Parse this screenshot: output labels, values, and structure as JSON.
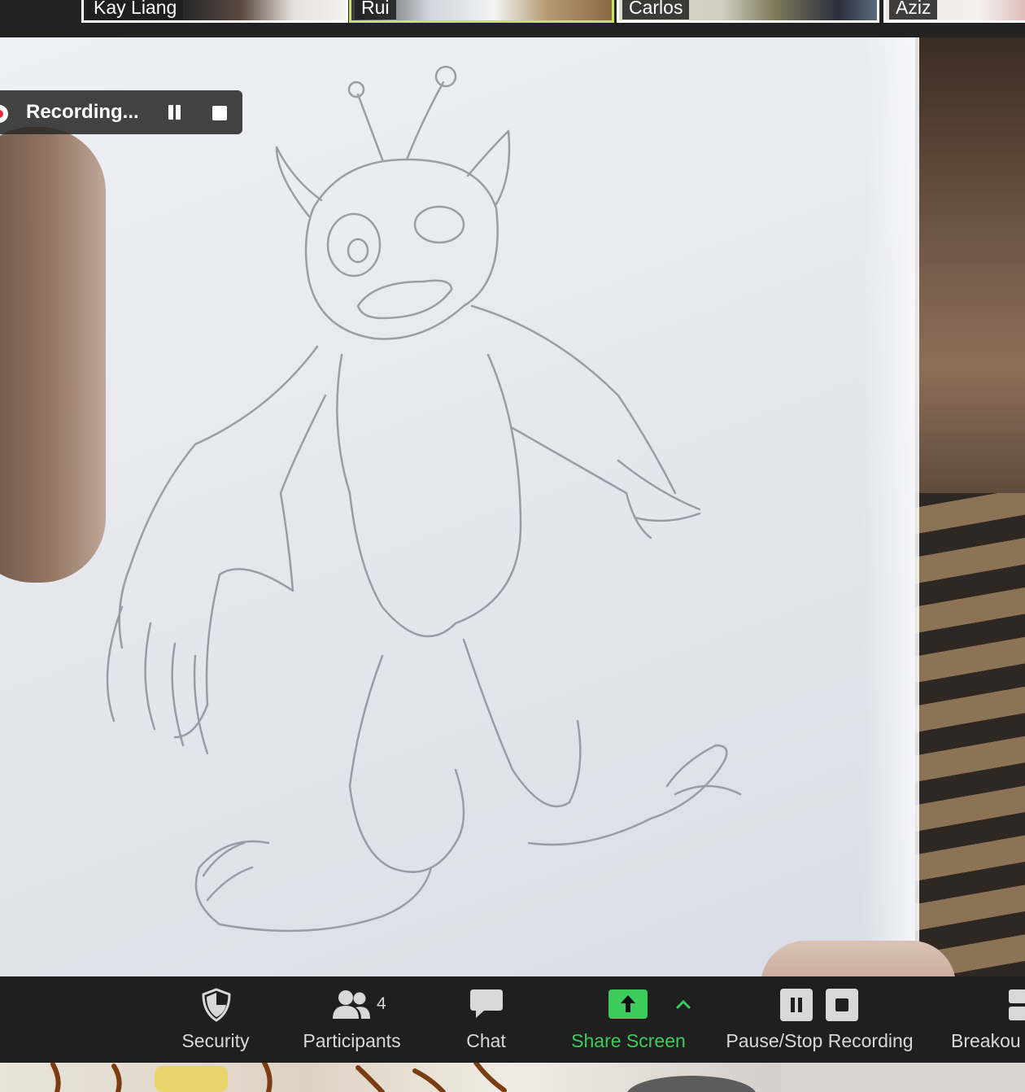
{
  "participants": [
    {
      "name": "Kay Liang",
      "active": false
    },
    {
      "name": "Rui",
      "active": true
    },
    {
      "name": "Carlos",
      "active": false
    },
    {
      "name": "Aziz",
      "active": false
    }
  ],
  "recording": {
    "status_label": "Recording...",
    "indicator_color": "#e8293d"
  },
  "toolbar": {
    "security_label": "Security",
    "participants_label": "Participants",
    "participants_count": "4",
    "chat_label": "Chat",
    "share_label": "Share Screen",
    "recording_label": "Pause/Stop Recording",
    "breakout_label": "Breakou",
    "share_color": "#3dcc5c"
  }
}
